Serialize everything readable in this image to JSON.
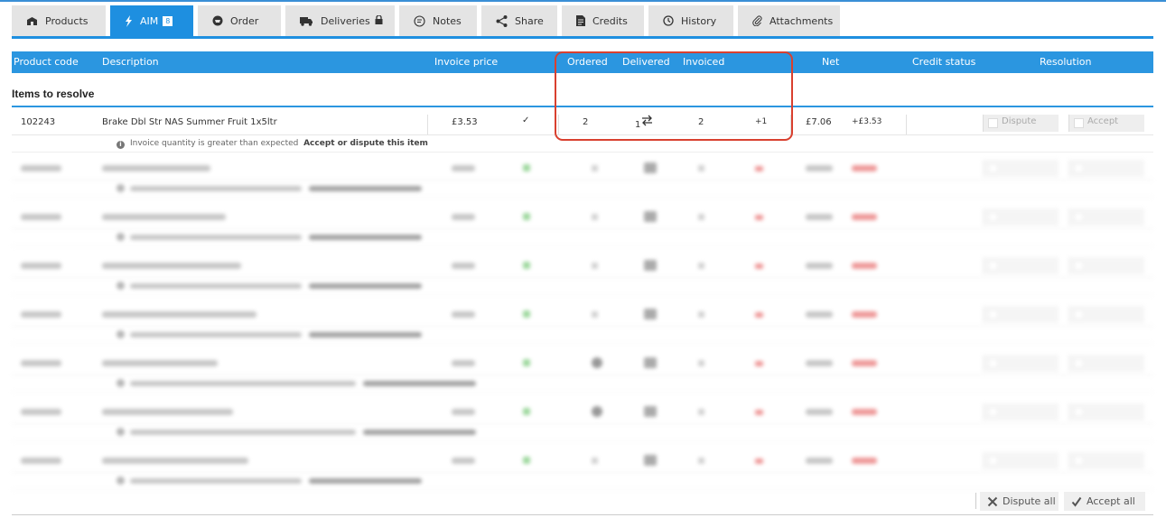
{
  "tabs": [
    {
      "label": "Products",
      "icon": "products-icon",
      "active": false
    },
    {
      "label": "AIM",
      "icon": "lightning-icon",
      "active": true,
      "badge": "8"
    },
    {
      "label": "Order",
      "icon": "order-icon",
      "active": false
    },
    {
      "label": "Deliveries",
      "icon": "truck-icon",
      "active": false
    },
    {
      "label": "Notes",
      "icon": "notes-icon",
      "active": false
    },
    {
      "label": "Share",
      "icon": "share-icon",
      "active": false
    },
    {
      "label": "Credits",
      "icon": "credits-icon",
      "active": false
    },
    {
      "label": "History",
      "icon": "clock-icon",
      "active": false
    },
    {
      "label": "Attachments",
      "icon": "paperclip-icon",
      "active": false
    }
  ],
  "columns": {
    "product_code": "Product code",
    "description": "Description",
    "invoice_price": "Invoice price",
    "ordered": "Ordered",
    "delivered": "Delivered",
    "invoiced": "Invoiced",
    "net": "Net",
    "credit_status": "Credit status",
    "resolution": "Resolution"
  },
  "section_title": "Items to resolve",
  "item": {
    "code": "102243",
    "description": "Brake Dbl Str NAS Summer Fruit 1x5ltr",
    "invoice_price": "£3.53",
    "ordered": "2",
    "delivered": "1",
    "invoiced": "2",
    "diff": "+1",
    "net": "£7.06",
    "net_diff": "+£3.53",
    "dispute_label": "Dispute",
    "accept_label": "Accept",
    "note": "Invoice quantity is greater than expected",
    "note_action": "Accept or dispute this item"
  },
  "footer": {
    "dispute_all": "Dispute all",
    "accept_all": "Accept all"
  },
  "colors": {
    "accent": "#2b96e0",
    "highlight": "#d9402f",
    "tick": "#4fb84f",
    "diff_red": "#e04444"
  }
}
